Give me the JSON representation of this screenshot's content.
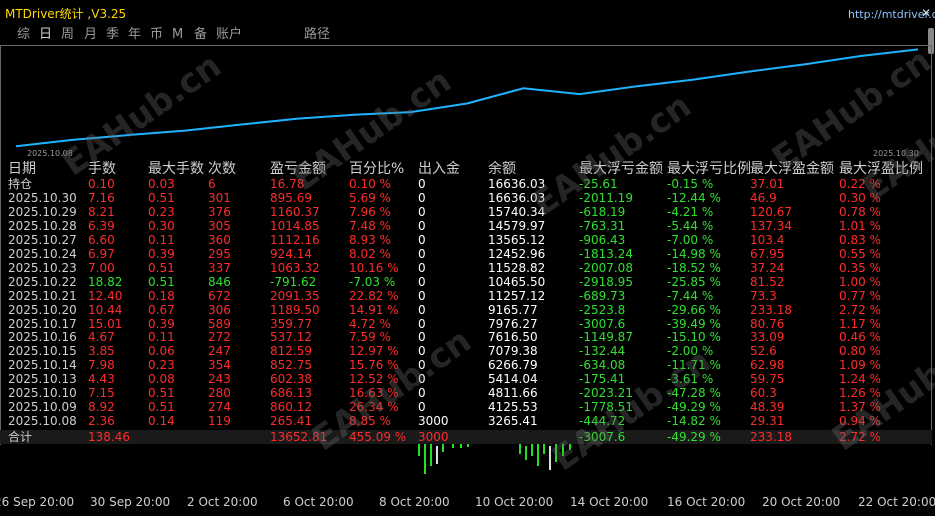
{
  "app": {
    "title": "MTDriver统计 ,V3.25",
    "url": "http://mtdriver.com",
    "close_icon": "close-icon"
  },
  "tabs": [
    {
      "label": "综",
      "active": false
    },
    {
      "label": "日",
      "active": true
    },
    {
      "label": "周",
      "active": false
    },
    {
      "label": "月",
      "active": false
    },
    {
      "label": "季",
      "active": false
    },
    {
      "label": "年",
      "active": false
    },
    {
      "label": "币",
      "active": false
    },
    {
      "label": "M",
      "active": false
    },
    {
      "label": "备",
      "active": false
    },
    {
      "label": "账户",
      "active": false
    },
    {
      "label": "路径",
      "active": false
    }
  ],
  "equity_chart": {
    "start_label": "2025.10.08",
    "end_label": "2025.10.30",
    "line_color": "#1fb3ff",
    "x": [
      "2025.10.08",
      "2025.10.09",
      "2025.10.10",
      "2025.10.13",
      "2025.10.14",
      "2025.10.15",
      "2025.10.16",
      "2025.10.17",
      "2025.10.20",
      "2025.10.21",
      "2025.10.22",
      "2025.10.23",
      "2025.10.24",
      "2025.10.27",
      "2025.10.28",
      "2025.10.29",
      "2025.10.30"
    ],
    "values": [
      3265.41,
      4125.53,
      4811.66,
      5414.04,
      6266.79,
      7079.38,
      7616.5,
      7976.27,
      9165.77,
      11257.12,
      10465.5,
      11528.82,
      12452.96,
      13565.12,
      14579.97,
      15740.34,
      16636.03
    ]
  },
  "watermark": "EAHub.cn",
  "table": {
    "headers": [
      "日期",
      "手数",
      "最大手数",
      "次数",
      "盈亏金额",
      "百分比%",
      "出入金",
      "余额",
      "最大浮亏金额",
      "最大浮亏比例",
      "最大浮盈金额",
      "最大浮盈比例"
    ],
    "holding": {
      "date": "持仓",
      "lots": "0.10",
      "max_lots": "0.03",
      "count": "6",
      "pnl": "16.78",
      "pct": "0.10 %",
      "io": "0",
      "balance": "16636.03",
      "max_dd": "-25.61",
      "max_dd_pct": "-0.15 %",
      "max_fp": "37.01",
      "max_fp_pct": "0.22 %"
    },
    "rows": [
      {
        "date": "2025.10.30",
        "lots": "7.16",
        "max_lots": "0.51",
        "count": "301",
        "pnl": "895.69",
        "pct": "5.69 %",
        "io": "0",
        "balance": "16636.03",
        "max_dd": "-2011.19",
        "max_dd_pct": "-12.44 %",
        "max_fp": "46.9",
        "max_fp_pct": "0.30 %",
        "color": "red"
      },
      {
        "date": "2025.10.29",
        "lots": "8.21",
        "max_lots": "0.23",
        "count": "376",
        "pnl": "1160.37",
        "pct": "7.96 %",
        "io": "0",
        "balance": "15740.34",
        "max_dd": "-618.19",
        "max_dd_pct": "-4.21 %",
        "max_fp": "120.67",
        "max_fp_pct": "0.78 %",
        "color": "red"
      },
      {
        "date": "2025.10.28",
        "lots": "6.39",
        "max_lots": "0.30",
        "count": "305",
        "pnl": "1014.85",
        "pct": "7.48 %",
        "io": "0",
        "balance": "14579.97",
        "max_dd": "-763.31",
        "max_dd_pct": "-5.44 %",
        "max_fp": "137.34",
        "max_fp_pct": "1.01 %",
        "color": "red"
      },
      {
        "date": "2025.10.27",
        "lots": "6.60",
        "max_lots": "0.11",
        "count": "360",
        "pnl": "1112.16",
        "pct": "8.93 %",
        "io": "0",
        "balance": "13565.12",
        "max_dd": "-906.43",
        "max_dd_pct": "-7.00 %",
        "max_fp": "103.4",
        "max_fp_pct": "0.83 %",
        "color": "red"
      },
      {
        "date": "2025.10.24",
        "lots": "6.97",
        "max_lots": "0.39",
        "count": "295",
        "pnl": "924.14",
        "pct": "8.02 %",
        "io": "0",
        "balance": "12452.96",
        "max_dd": "-1813.24",
        "max_dd_pct": "-14.98 %",
        "max_fp": "67.95",
        "max_fp_pct": "0.55 %",
        "color": "red"
      },
      {
        "date": "2025.10.23",
        "lots": "7.00",
        "max_lots": "0.51",
        "count": "337",
        "pnl": "1063.32",
        "pct": "10.16 %",
        "io": "0",
        "balance": "11528.82",
        "max_dd": "-2007.08",
        "max_dd_pct": "-18.52 %",
        "max_fp": "37.24",
        "max_fp_pct": "0.35 %",
        "color": "red"
      },
      {
        "date": "2025.10.22",
        "lots": "18.82",
        "max_lots": "0.51",
        "count": "846",
        "pnl": "-791.62",
        "pct": "-7.03 %",
        "io": "0",
        "balance": "10465.50",
        "max_dd": "-2918.95",
        "max_dd_pct": "-25.85 %",
        "max_fp": "81.52",
        "max_fp_pct": "1.00 %",
        "color": "green"
      },
      {
        "date": "2025.10.21",
        "lots": "12.40",
        "max_lots": "0.18",
        "count": "672",
        "pnl": "2091.35",
        "pct": "22.82 %",
        "io": "0",
        "balance": "11257.12",
        "max_dd": "-689.73",
        "max_dd_pct": "-7.44 %",
        "max_fp": "73.3",
        "max_fp_pct": "0.77 %",
        "color": "red"
      },
      {
        "date": "2025.10.20",
        "lots": "10.44",
        "max_lots": "0.67",
        "count": "306",
        "pnl": "1189.50",
        "pct": "14.91 %",
        "io": "0",
        "balance": "9165.77",
        "max_dd": "-2523.8",
        "max_dd_pct": "-29.66 %",
        "max_fp": "233.18",
        "max_fp_pct": "2.72 %",
        "color": "red"
      },
      {
        "date": "2025.10.17",
        "lots": "15.01",
        "max_lots": "0.39",
        "count": "589",
        "pnl": "359.77",
        "pct": "4.72 %",
        "io": "0",
        "balance": "7976.27",
        "max_dd": "-3007.6",
        "max_dd_pct": "-39.49 %",
        "max_fp": "80.76",
        "max_fp_pct": "1.17 %",
        "color": "red"
      },
      {
        "date": "2025.10.16",
        "lots": "4.67",
        "max_lots": "0.11",
        "count": "272",
        "pnl": "537.12",
        "pct": "7.59 %",
        "io": "0",
        "balance": "7616.50",
        "max_dd": "-1149.87",
        "max_dd_pct": "-15.10 %",
        "max_fp": "33.09",
        "max_fp_pct": "0.46 %",
        "color": "red"
      },
      {
        "date": "2025.10.15",
        "lots": "3.85",
        "max_lots": "0.06",
        "count": "247",
        "pnl": "812.59",
        "pct": "12.97 %",
        "io": "0",
        "balance": "7079.38",
        "max_dd": "-132.44",
        "max_dd_pct": "-2.00 %",
        "max_fp": "52.6",
        "max_fp_pct": "0.80 %",
        "color": "red"
      },
      {
        "date": "2025.10.14",
        "lots": "7.98",
        "max_lots": "0.23",
        "count": "354",
        "pnl": "852.75",
        "pct": "15.76 %",
        "io": "0",
        "balance": "6266.79",
        "max_dd": "-634.08",
        "max_dd_pct": "-11.71 %",
        "max_fp": "62.98",
        "max_fp_pct": "1.09 %",
        "color": "red"
      },
      {
        "date": "2025.10.13",
        "lots": "4.43",
        "max_lots": "0.08",
        "count": "243",
        "pnl": "602.38",
        "pct": "12.52 %",
        "io": "0",
        "balance": "5414.04",
        "max_dd": "-175.41",
        "max_dd_pct": "-3.61 %",
        "max_fp": "59.75",
        "max_fp_pct": "1.24 %",
        "color": "red"
      },
      {
        "date": "2025.10.10",
        "lots": "7.15",
        "max_lots": "0.51",
        "count": "280",
        "pnl": "686.13",
        "pct": "16.63 %",
        "io": "0",
        "balance": "4811.66",
        "max_dd": "-2023.21",
        "max_dd_pct": "-47.28 %",
        "max_fp": "60.3",
        "max_fp_pct": "1.26 %",
        "color": "red"
      },
      {
        "date": "2025.10.09",
        "lots": "8.92",
        "max_lots": "0.51",
        "count": "274",
        "pnl": "860.12",
        "pct": "26.34 %",
        "io": "0",
        "balance": "4125.53",
        "max_dd": "-1778.51",
        "max_dd_pct": "-49.29 %",
        "max_fp": "48.39",
        "max_fp_pct": "1.37 %",
        "color": "red"
      },
      {
        "date": "2025.10.08",
        "lots": "2.36",
        "max_lots": "0.14",
        "count": "119",
        "pnl": "265.41",
        "pct": "8.85 %",
        "io": "3000",
        "balance": "3265.41",
        "max_dd": "-444.72",
        "max_dd_pct": "-14.82 %",
        "max_fp": "29.31",
        "max_fp_pct": "0.94 %",
        "color": "red"
      }
    ],
    "total": {
      "label": "合计",
      "lots": "138.46",
      "pnl": "13652.81",
      "pct": "455.09 %",
      "io": "3000",
      "max_dd": "-3007.6",
      "max_dd_pct": "-49.29 %",
      "max_fp": "233.18",
      "max_fp_pct": "2.72 %"
    }
  },
  "time_axis": [
    "26 Sep 20:00",
    "30 Sep 20:00",
    "2 Oct 20:00",
    "6 Oct 20:00",
    "8 Oct 20:00",
    "10 Oct 20:00",
    "14 Oct 20:00",
    "16 Oct 20:00",
    "20 Oct 20:00",
    "22 Oct 20:00"
  ],
  "colors": {
    "positive": "#ff2b2b",
    "negative": "#30e030",
    "text": "#cfcfcf",
    "title": "#ffd800",
    "line": "#1fb3ff"
  }
}
